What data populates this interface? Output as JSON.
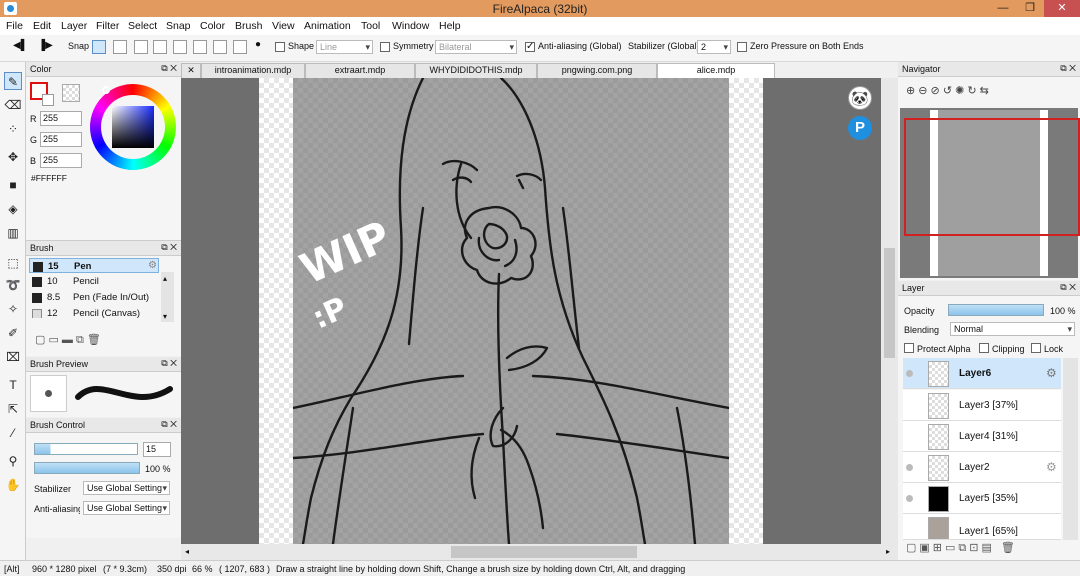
{
  "window": {
    "title": "FireAlpaca (32bit)"
  },
  "menu": [
    "File",
    "Edit",
    "Layer",
    "Filter",
    "Select",
    "Snap",
    "Color",
    "Brush",
    "View",
    "Animation",
    "Tool",
    "Window",
    "Help"
  ],
  "toolbar": {
    "snap_label": "Snap",
    "shape_label": "Shape",
    "shape_value": "Line",
    "symmetry_label": "Symmetry",
    "symmetry_value": "Bilateral",
    "antialias_label": "Anti-aliasing (Global)",
    "stabilizer_label": "Stabilizer (Global)",
    "stabilizer_value": "2",
    "zero_pressure_label": "Zero Pressure on Both Ends"
  },
  "color_panel": {
    "title": "Color",
    "r_label": "R",
    "r": "255",
    "g_label": "G",
    "g": "255",
    "b_label": "B",
    "b": "255",
    "hex": "#FFFFFF"
  },
  "brush_panel": {
    "title": "Brush",
    "items": [
      {
        "size": "15",
        "name": "Pen"
      },
      {
        "size": "10",
        "name": "Pencil"
      },
      {
        "size": "8.5",
        "name": "Pen (Fade In/Out)"
      },
      {
        "size": "12",
        "name": "Pencil (Canvas)"
      }
    ]
  },
  "brush_preview": {
    "title": "Brush Preview"
  },
  "brush_control": {
    "title": "Brush Control",
    "size": "15",
    "opacity": "100 %",
    "stabilizer_label": "Stabilizer",
    "stabilizer_value": "Use Global Setting",
    "antialias_label": "Anti-aliasing",
    "antialias_value": "Use Global Setting"
  },
  "tabs": [
    "introanimation.mdp",
    "extraart.mdp",
    "WHYDIDIDOTHIS.mdp",
    "pngwing.com.png",
    "alice.mdp"
  ],
  "canvas": {
    "wip_text": "WIP",
    "wip_face": ":P"
  },
  "navigator": {
    "title": "Navigator"
  },
  "layer_panel": {
    "title": "Layer",
    "opacity_label": "Opacity",
    "opacity_value": "100 %",
    "blending_label": "Blending",
    "blending_value": "Normal",
    "protect_alpha": "Protect Alpha",
    "clipping": "Clipping",
    "lock": "Lock",
    "layers": [
      {
        "name": "Layer6"
      },
      {
        "name": "Layer3 [37%]"
      },
      {
        "name": "Layer4 [31%]"
      },
      {
        "name": "Layer2"
      },
      {
        "name": "Layer5 [35%]"
      },
      {
        "name": "Layer1 [65%]"
      }
    ]
  },
  "status": {
    "mod": "[Alt]",
    "size": "960 * 1280 pixel",
    "cm": "(7 * 9.3cm)",
    "dpi": "350 dpi",
    "zoom": "66 %",
    "coords": "( 1207, 683 )",
    "hint": "Draw a straight line by holding down Shift, Change a brush size by holding down Ctrl, Alt, and dragging"
  },
  "colors": {
    "titlebar": "#e39a5e",
    "selection": "#cfe6fb",
    "accent": "#5b8fc8"
  }
}
